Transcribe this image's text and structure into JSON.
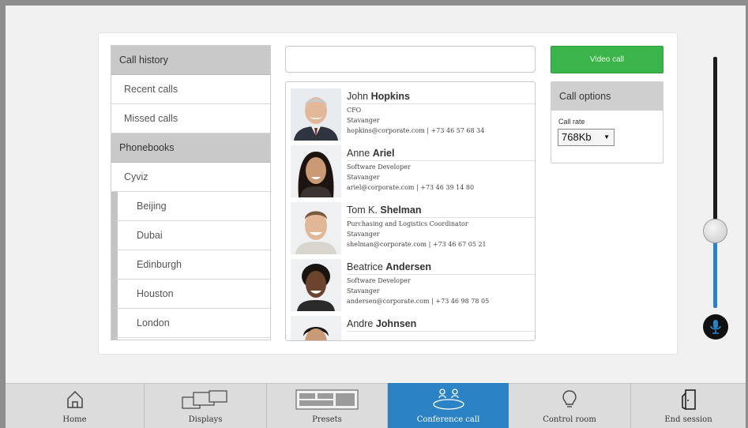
{
  "left_list": {
    "call_history_header": "Call history",
    "recent_calls": "Recent calls",
    "missed_calls": "Missed calls",
    "phonebooks_header": "Phonebooks",
    "cyviz": "Cyviz",
    "locations": [
      "Beijing",
      "Dubai",
      "Edinburgh",
      "Houston",
      "London"
    ]
  },
  "search": {
    "value": ""
  },
  "contacts": [
    {
      "first": "John",
      "last": "Hopkins",
      "title": "CFO",
      "location": "Stavanger",
      "contact": "hopkins@corporate.com | +73 46 57 68 34"
    },
    {
      "first": "Anne",
      "last": "Ariel",
      "title": "Software Developer",
      "location": "Stavanger",
      "contact": "ariel@corporate.com | +73 46 39 14 80"
    },
    {
      "first": "Tom K.",
      "last": "Shelman",
      "title": "Purchasing and Logistics Coordinator",
      "location": "Stavanger",
      "contact": "shelman@corporate.com | +73 46 67 05 21"
    },
    {
      "first": "Beatrice",
      "last": "Andersen",
      "title": "Software Developer",
      "location": "Stavanger",
      "contact": "andersen@corporate.com | +73 46 98 78 05"
    },
    {
      "first": "Andre",
      "last": "Johnsen",
      "title": "",
      "location": "",
      "contact": ""
    }
  ],
  "video_call": {
    "label": "Video call"
  },
  "call_options": {
    "header": "Call options",
    "call_rate_label": "Call rate",
    "call_rate_value": "768Kb"
  },
  "volume": {
    "level": 0.42
  },
  "nav": {
    "home": "Home",
    "displays": "Displays",
    "presets": "Presets",
    "conference_call": "Conference call",
    "control_room": "Control room",
    "end_session": "End session",
    "active": "conference_call"
  },
  "colors": {
    "accent_blue": "#2b82c5",
    "video_call_green": "#3bb54a"
  }
}
